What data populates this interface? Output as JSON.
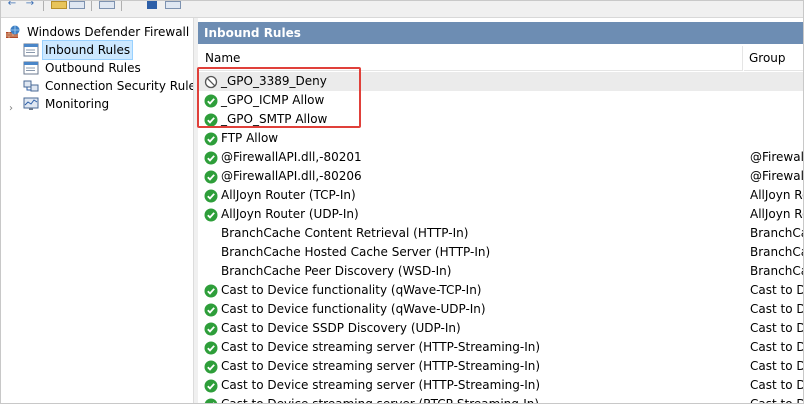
{
  "tree": {
    "root_label": "Windows Defender Firewall witl",
    "items": [
      {
        "label": "Inbound Rules",
        "selected": true
      },
      {
        "label": "Outbound Rules",
        "selected": false
      },
      {
        "label": "Connection Security Rules",
        "selected": false
      },
      {
        "label": "Monitoring",
        "selected": false
      }
    ]
  },
  "pane": {
    "title": "Inbound Rules",
    "columns": {
      "name": "Name",
      "group": "Group"
    }
  },
  "rules": [
    {
      "name": "_GPO_3389_Deny",
      "group": "",
      "icon": "block-icon"
    },
    {
      "name": "_GPO_ICMP Allow",
      "group": "",
      "icon": "allow-icon"
    },
    {
      "name": "_GPO_SMTP Allow",
      "group": "",
      "icon": "allow-icon"
    },
    {
      "name": "FTP Allow",
      "group": "",
      "icon": "allow-icon"
    },
    {
      "name": "@FirewallAPI.dll,-80201",
      "group": "@FirewallA",
      "icon": "allow-icon"
    },
    {
      "name": "@FirewallAPI.dll,-80206",
      "group": "@FirewallA",
      "icon": "allow-icon"
    },
    {
      "name": "AllJoyn Router (TCP-In)",
      "group": "AllJoyn Ro",
      "icon": "allow-icon"
    },
    {
      "name": "AllJoyn Router (UDP-In)",
      "group": "AllJoyn Ro",
      "icon": "allow-icon"
    },
    {
      "name": "BranchCache Content Retrieval (HTTP-In)",
      "group": "BranchCac",
      "icon": "none"
    },
    {
      "name": "BranchCache Hosted Cache Server (HTTP-In)",
      "group": "BranchCac",
      "icon": "none"
    },
    {
      "name": "BranchCache Peer Discovery (WSD-In)",
      "group": "BranchCac",
      "icon": "none"
    },
    {
      "name": "Cast to Device functionality (qWave-TCP-In)",
      "group": "Cast to De",
      "icon": "allow-icon"
    },
    {
      "name": "Cast to Device functionality (qWave-UDP-In)",
      "group": "Cast to De",
      "icon": "allow-icon"
    },
    {
      "name": "Cast to Device SSDP Discovery (UDP-In)",
      "group": "Cast to De",
      "icon": "allow-icon"
    },
    {
      "name": "Cast to Device streaming server (HTTP-Streaming-In)",
      "group": "Cast to De",
      "icon": "allow-icon"
    },
    {
      "name": "Cast to Device streaming server (HTTP-Streaming-In)",
      "group": "Cast to De",
      "icon": "allow-icon"
    },
    {
      "name": "Cast to Device streaming server (HTTP-Streaming-In)",
      "group": "Cast to De",
      "icon": "allow-icon"
    },
    {
      "name": "Cast to Device streaming server (RTCP-Streaming-In)",
      "group": "Cast to De",
      "icon": "allow-icon"
    }
  ],
  "colors": {
    "accent_header": "#6d8db3",
    "allow_green": "#2e9e3a",
    "highlight_red": "#e0403a",
    "selection_blue": "#cce8ff"
  }
}
